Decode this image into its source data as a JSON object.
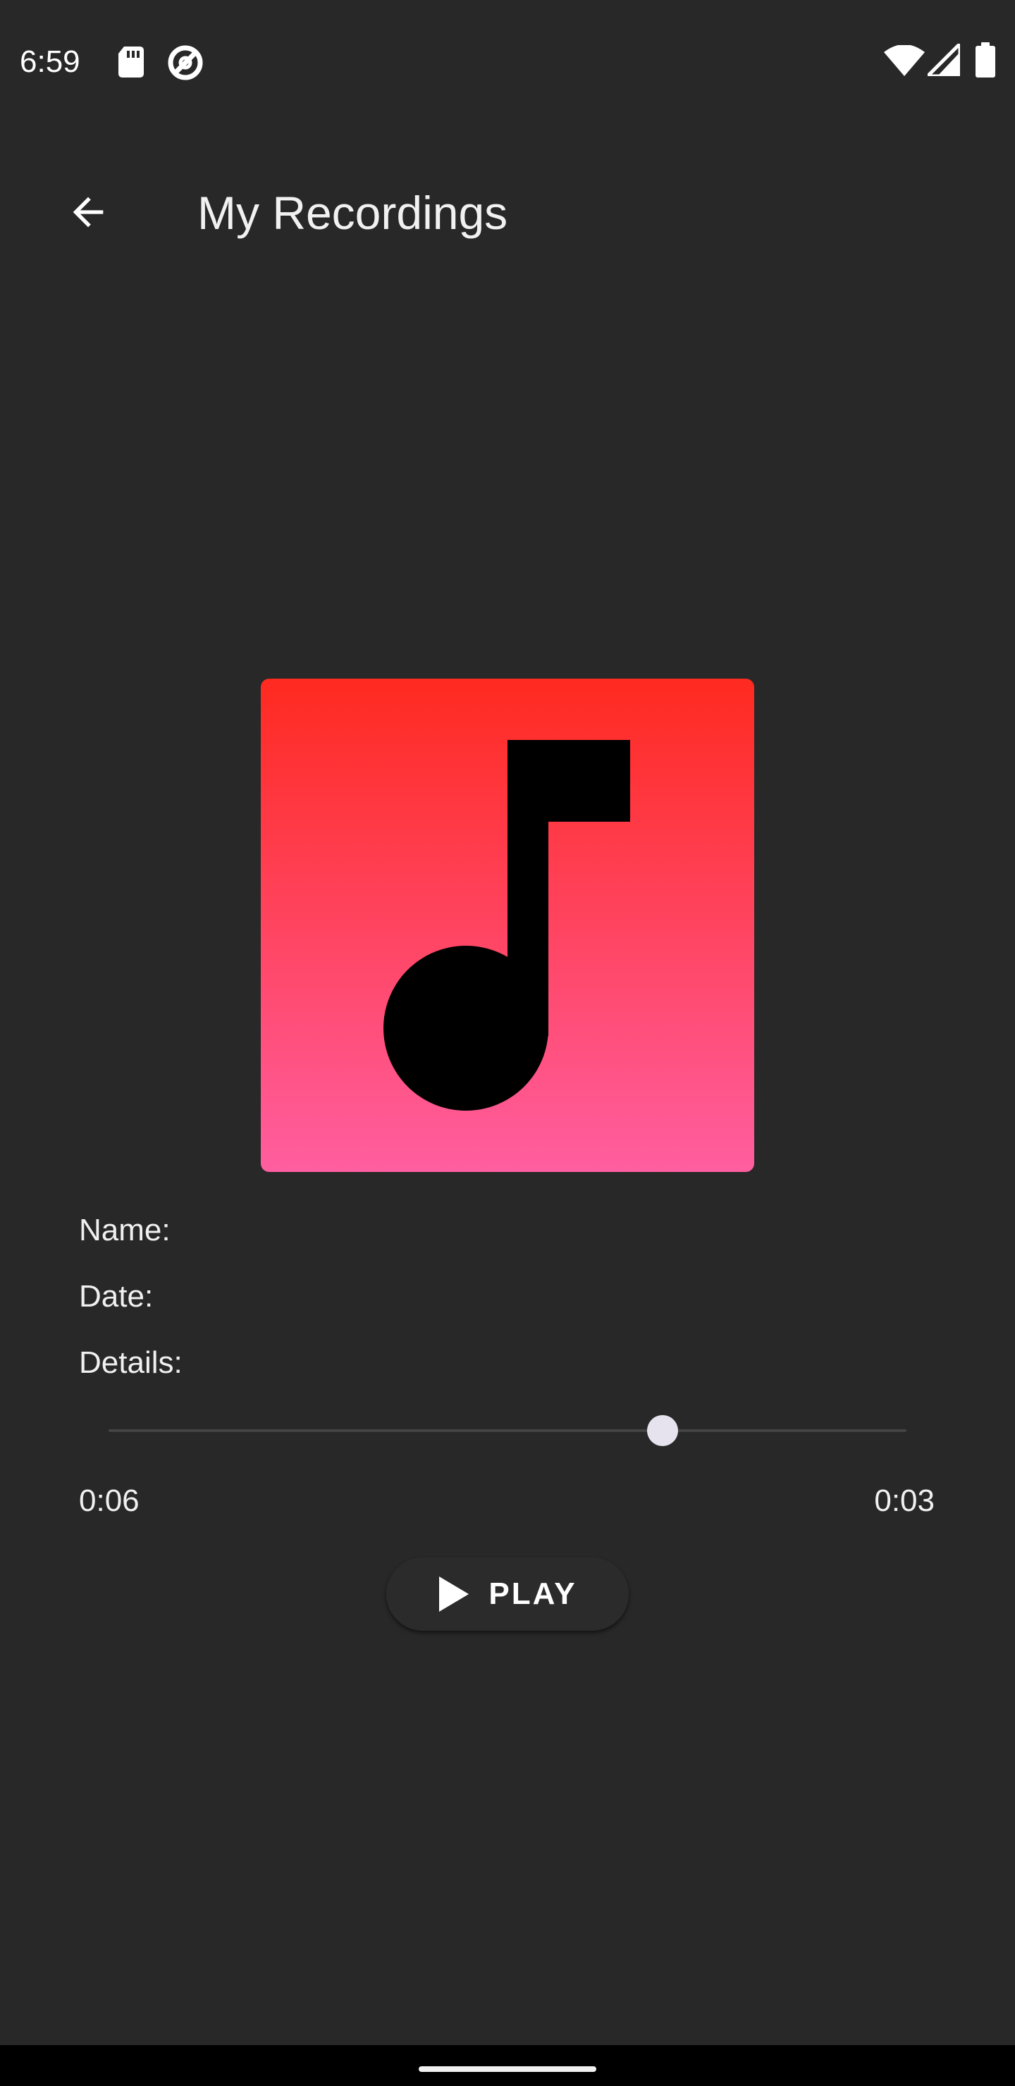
{
  "status_bar": {
    "time": "6:59",
    "icons": [
      "sd-card-icon",
      "data-saver-icon",
      "wifi-icon",
      "cell-signal-icon",
      "battery-icon"
    ]
  },
  "app_bar": {
    "back_icon": "arrow-back-icon",
    "title": "My Recordings"
  },
  "artwork": {
    "icon": "music-note-icon",
    "gradient_top": "#ff2a20",
    "gradient_bottom": "#ff5ea0"
  },
  "details": {
    "name_label": "Name:",
    "date_label": "Date:",
    "details_label": "Details:"
  },
  "player": {
    "elapsed": "0:06",
    "remaining": "0:03",
    "progress_percent": 69.4,
    "play_label": "PLAY",
    "play_icon": "play-icon"
  },
  "colors": {
    "background": "#282828",
    "thumb": "#e6e3ee"
  }
}
